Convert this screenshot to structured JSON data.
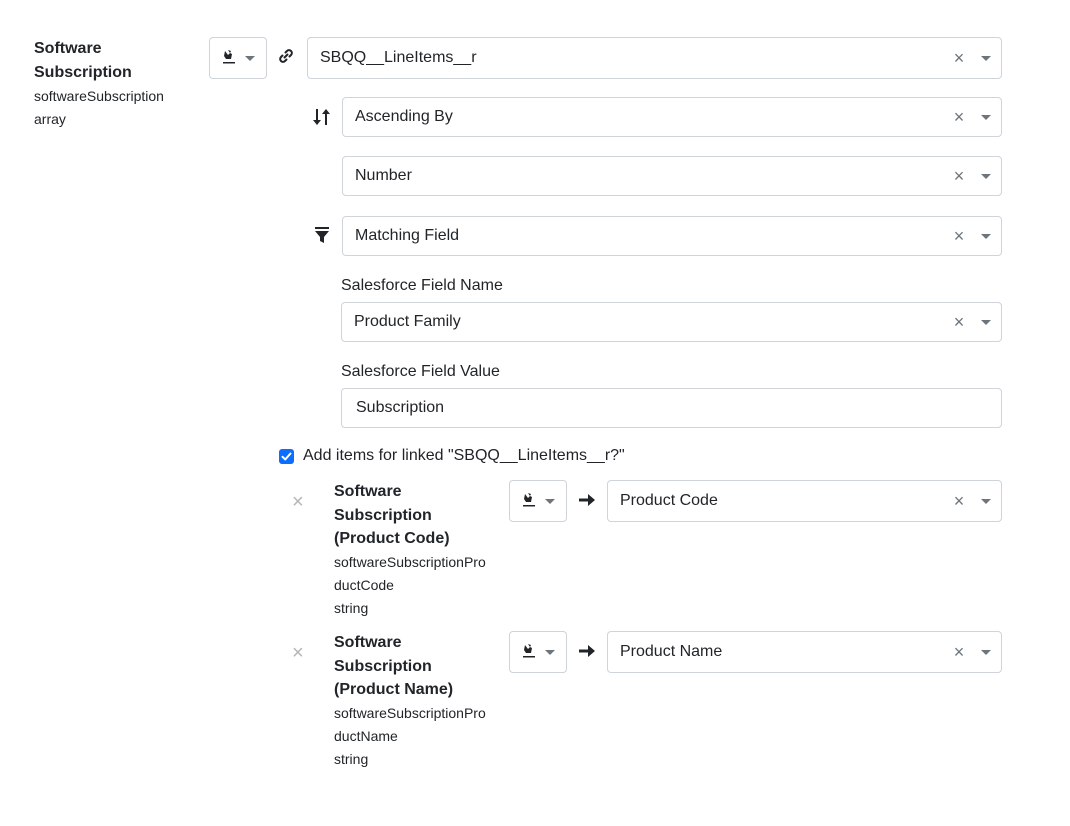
{
  "main_field": {
    "title": "Software Subscription",
    "name": "softwareSubscription",
    "type": "array",
    "source_value": "SBQQ__LineItems__r"
  },
  "sort": {
    "direction_value": "Ascending By",
    "field_value": "Number"
  },
  "filter": {
    "type_value": "Matching Field",
    "field_name_label": "Salesforce Field Name",
    "field_name_value": "Product Family",
    "field_value_label": "Salesforce Field Value",
    "field_value_value": "Subscription"
  },
  "add_items": {
    "label": "Add items for linked \"SBQQ__LineItems__r?\"",
    "checked": true
  },
  "sub_fields": [
    {
      "title_line1": "Software",
      "title_line2": "Subscription",
      "title_line3": "(Product Code)",
      "name_line1": "softwareSubscriptionPro",
      "name_line2": "ductCode",
      "type": "string",
      "mapped_value": "Product Code"
    },
    {
      "title_line1": "Software",
      "title_line2": "Subscription",
      "title_line3": "(Product Name)",
      "name_line1": "softwareSubscriptionPro",
      "name_line2": "ductName",
      "type": "string",
      "mapped_value": "Product Name"
    }
  ],
  "icons": {
    "clear": "×",
    "remove": "×",
    "arrow": "arrow-right-icon",
    "link": "link-icon",
    "sort": "sort-icon",
    "filter": "filter-icon",
    "source_type": "salesforce-source-icon"
  }
}
